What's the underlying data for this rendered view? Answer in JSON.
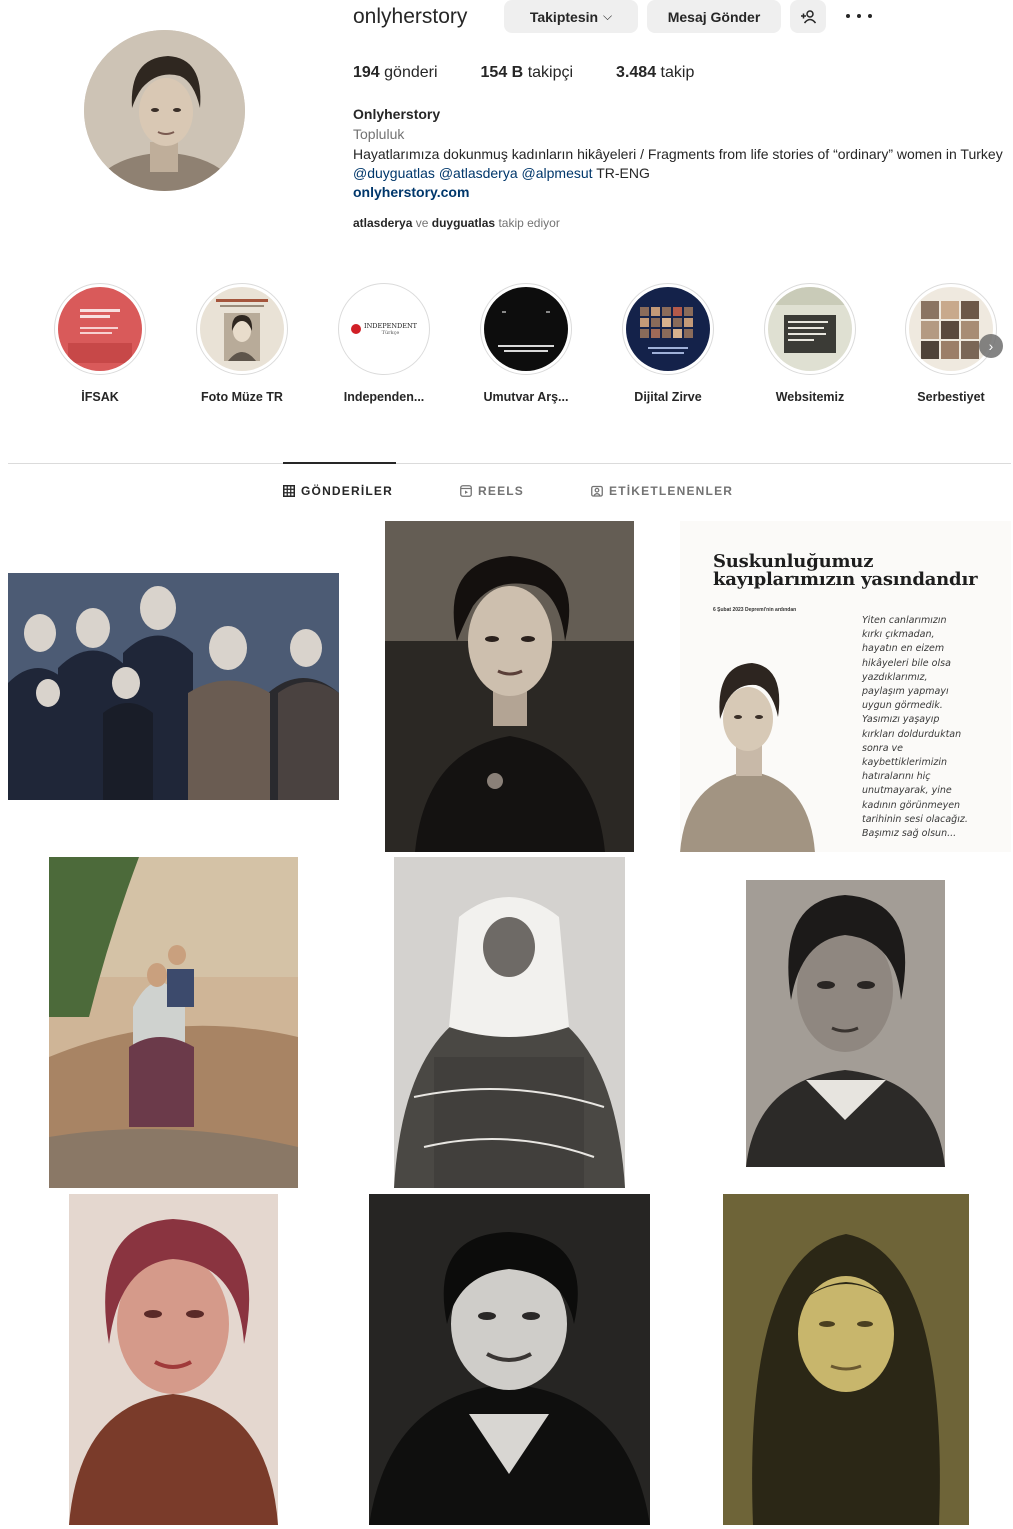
{
  "profile": {
    "username": "onlyherstory",
    "follow_button": "Takiptesin",
    "message_button": "Mesaj Gönder",
    "add_user_icon": "add-user-icon",
    "more_icon": "more-options-icon",
    "stats": {
      "posts_count": "194",
      "posts_label": "gönderi",
      "followers_count": "154 B",
      "followers_label": "takipçi",
      "following_count": "3.484",
      "following_label": "takip"
    },
    "display_name": "Onlyherstory",
    "category": "Topluluk",
    "bio_text": "Hayatlarımıza dokunmuş kadınların hikâyeleri / Fragments from life stories of “ordinary” women in Turkey",
    "bio_mentions": [
      "@duyguatlas",
      "@atlasderya",
      "@alpmesut"
    ],
    "bio_suffix": "TR-ENG",
    "link": "onlyherstory.com",
    "followed_by_user1": "atlasderya",
    "followed_by_and": "ve",
    "followed_by_user2": "duyguatlas",
    "followed_by_suffix": "takip ediyor"
  },
  "highlights": [
    {
      "label": "İFSAK"
    },
    {
      "label": "Foto Müze TR"
    },
    {
      "label": "Independen...",
      "logo_text": "INDEPENDENT",
      "logo_sub": "Türkçe"
    },
    {
      "label": "Umutvar Arş..."
    },
    {
      "label": "Dijital Zirve"
    },
    {
      "label": "Websitemiz"
    },
    {
      "label": "Serbestiyet"
    }
  ],
  "tabs": [
    {
      "label": "GÖNDERİLER",
      "icon": "grid-icon",
      "active": true
    },
    {
      "label": "REELS",
      "icon": "reels-icon",
      "active": false
    },
    {
      "label": "ETİKETLENENLER",
      "icon": "tagged-icon",
      "active": false
    }
  ],
  "poster": {
    "title_line1": "Suskunluğumuz",
    "title_line2": "kayıplarımızın yasındandır",
    "subtitle": "6 Şubat 2023 Depremi'nin ardından",
    "lines": [
      "Yiten canlarımızın",
      "kırkı çıkmadan,",
      "hayatın en eizem",
      "hikâyeleri bile olsa",
      "yazdıklarımız,",
      "paylaşım yapmayı",
      "uygun görmedik.",
      "Yasımızı yaşayıp",
      "kırkları doldurduktan",
      "sonra ve",
      "kaybettiklerimizin",
      "hatıralarını hiç",
      "unutmayarak, yine",
      "kadının görünmeyen",
      "tarihinin sesi olacağız.",
      "Başımız sağ olsun..."
    ]
  },
  "colors": {
    "link": "#00376b",
    "muted": "#737373",
    "button_bg": "#efefef",
    "divider": "#dbdbdb"
  }
}
